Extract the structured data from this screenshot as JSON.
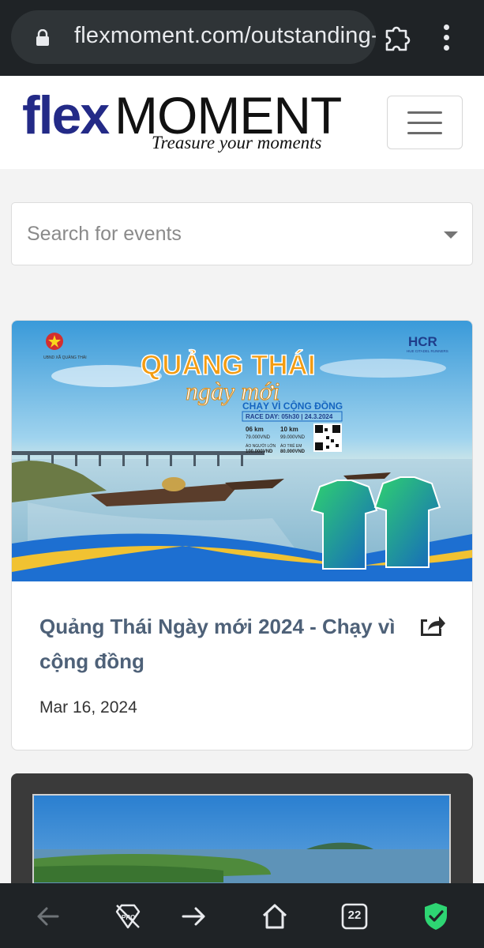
{
  "browser": {
    "url": "flexmoment.com/outstanding-e",
    "tab_count": "22"
  },
  "site": {
    "logo_flex": "flex",
    "logo_moment": "MOMENT",
    "tagline": "Treasure your moments"
  },
  "search": {
    "placeholder": "Search for events"
  },
  "event": {
    "title": "Quảng Thái Ngày mới 2024 - Chạy vì cộng đồng",
    "date": "Mar 16, 2024",
    "banner": {
      "org_left": "UBND XÃ QUẢNG THÁI",
      "title_line1": "QUẢNG THÁI",
      "title_line2": "ngày mới",
      "subtitle": "CHẠY VÌ CỘNG ĐỒNG",
      "race_day": "RACE DAY: 05h30 | 24.3.2024",
      "dist_6": "06 km",
      "price_6": "79.000VND",
      "dist_10": "10 km",
      "price_10": "99.000VND",
      "shirt_adult_label": "ÁO NGƯỜI LỚN",
      "shirt_adult_price": "100.000VND",
      "shirt_kid_label": "ÁO TRẺ EM",
      "shirt_kid_price": "80.000VND",
      "org_right": "HCR",
      "org_right_sub": "HUE CITADEL RUNNERS"
    }
  },
  "colors": {
    "brand_blue": "#232a87",
    "title_slate": "#4e6178",
    "browser_dark": "#1f2326",
    "shield_green": "#2ed573"
  },
  "icons": [
    "lock-icon",
    "extension-puzzle-icon",
    "more-vert-icon",
    "hamburger-menu-icon",
    "dropdown-caret-icon",
    "share-icon",
    "back-arrow-icon",
    "pro-diamond-icon",
    "forward-arrow-icon",
    "home-icon",
    "tabs-icon",
    "shield-check-icon"
  ]
}
